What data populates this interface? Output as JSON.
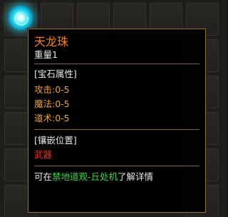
{
  "item": {
    "name": "天龙珠",
    "weight": "重量1",
    "icon": "cyan-orb-gem-icon"
  },
  "gem_attributes": {
    "header": "[宝石属性]",
    "stats": [
      "攻击:0-5",
      "魔法:0-5",
      "道术:0-5"
    ]
  },
  "inlay": {
    "header": "[镶嵌位置]",
    "slot": "武器"
  },
  "hint": {
    "prefix": "可在",
    "location": "禁地道观-丘处机",
    "suffix": "了解详情"
  },
  "colors": {
    "title": "#f08218",
    "stat": "#f0a030",
    "slot": "#e83020",
    "location": "#30d848",
    "border": "#8a7040"
  }
}
